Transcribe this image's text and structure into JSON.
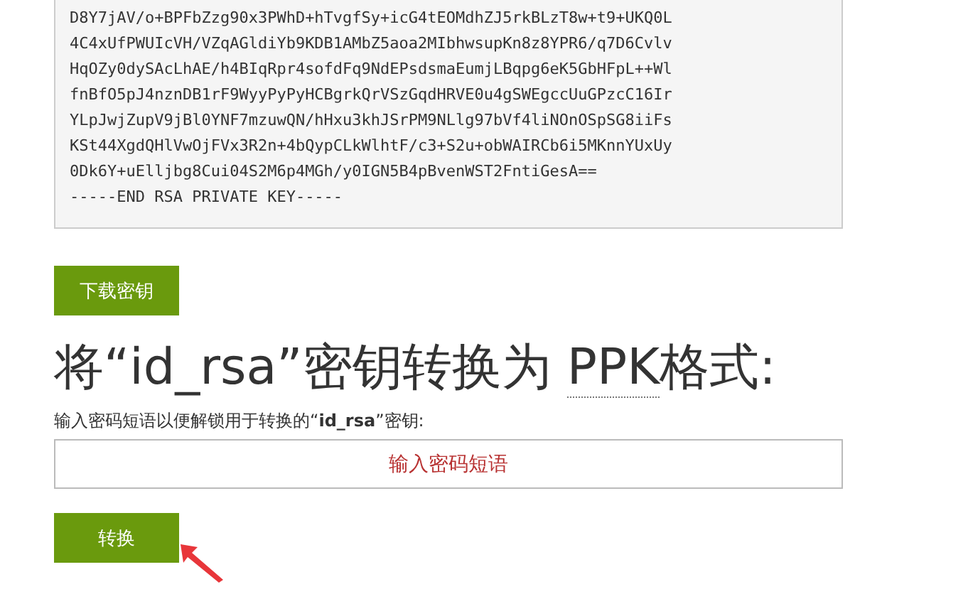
{
  "private_key": {
    "lines": [
      "D8Y7jAV/o+BPFbZzg90x3PWhD+hTvgfSy+icG4tEOMdhZJ5rkBLzT8w+t9+UKQ0L",
      "4C4xUfPWUIcVH/VZqAGldiYb9KDB1AMbZ5aoa2MIbhwsupKn8z8YPR6/q7D6Cvlv",
      "HqOZy0dySAcLhAE/h4BIqRpr4sofdFq9NdEPsdsmaEumjLBqpg6eK5GbHFpL++Wl",
      "fnBfO5pJ4nznDB1rF9WyyPyPyHCBgrkQrVSzGqdHRVE0u4gSWEgccUuGPzcC16Ir",
      "YLpJwjZupV9jBl0YNF7mzuwQN/hHxu3khJSrPM9NLlg97bVf4liNOnOSpSG8iiFs",
      "KSt44XgdQHlVwOjFVx3R2n+4bQypCLkWlhtF/c3+S2u+obWAIRCb6i5MKnnYUxUy",
      "0Dk6Y+uElljbg8Cui04S2M6p4MGh/y0IGN5B4pBvenWST2FntiGesA==",
      "-----END RSA PRIVATE KEY-----"
    ]
  },
  "download_button": "下载密钥",
  "heading": {
    "text_before": "将“id_rsa”密钥转换为 ",
    "abbreviation": "PPK",
    "text_after": "格式:"
  },
  "passphrase": {
    "label": "输入密码短语以便解锁用于转换的“**id_rsa**”密钥:",
    "placeholder": "输入密码短语"
  },
  "convert_button": "转换"
}
